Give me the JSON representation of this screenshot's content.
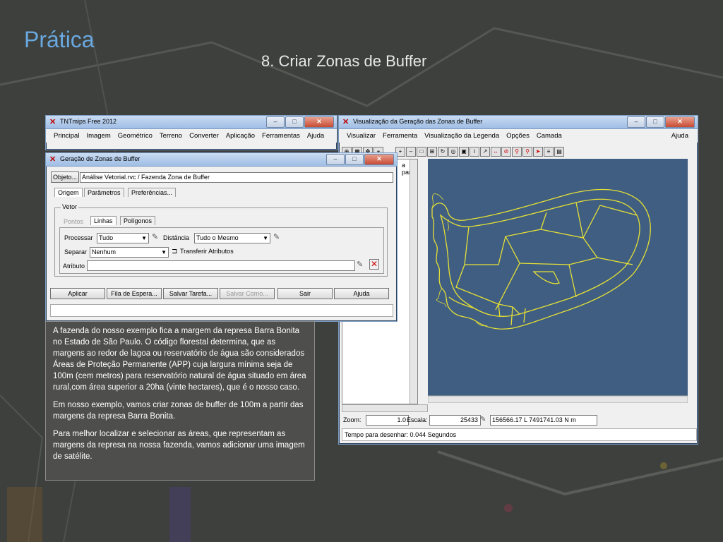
{
  "slide": {
    "title": "Prática",
    "subtitle": "8. Criar Zonas de Buffer"
  },
  "tnt_window": {
    "title": "TNTmips Free 2012",
    "menu": [
      "Principal",
      "Imagem",
      "Geométrico",
      "Terreno",
      "Converter",
      "Aplicação",
      "Ferramentas",
      "Ajuda"
    ]
  },
  "buffer_dialog": {
    "title": "Geração de Zonas de Buffer",
    "object_button": "Objeto...",
    "object_path": "Análise Vetorial.rvc / Fazenda Zona de Buffer",
    "tabs": [
      "Origem",
      "Parâmetros",
      "Preferências..."
    ],
    "group_label": "Vetor",
    "subtabs": [
      "Pontos",
      "Linhas",
      "Polígonos"
    ],
    "process_label": "Processar",
    "process_value": "Tudo",
    "distance_label": "Distância",
    "distance_value": "Tudo o Mesmo",
    "separate_label": "Separar",
    "separate_value": "Nenhum",
    "transfer_label": "Transferir Atributos",
    "attribute_label": "Atributo",
    "buttons": [
      "Aplicar",
      "Fila de Espera...",
      "Salvar Tarefa...",
      "Salvar Como...",
      "Sair",
      "Ajuda"
    ]
  },
  "viz_window": {
    "title": "Visualização da Geração das Zonas de Buffer",
    "menu": [
      "Visualizar",
      "Ferramenta",
      "Visualização da Legenda",
      "Opções",
      "Camada"
    ],
    "help": "Ajuda",
    "side_text": "a para",
    "zoom_label": "Zoom:",
    "zoom_value": "1.0",
    "scale_label": "Escala:",
    "scale_value": "25433",
    "coords": "156566.17 L 7491741.03 N m",
    "status": "Tempo para desenhar: 0.044 Segundos",
    "map_bg": "#3f5e82",
    "line_color": "#e6e035"
  },
  "description": {
    "p1": "A fazenda do nosso exemplo fica a margem da represa Barra Bonita no Estado de São Paulo. O código florestal determina, que as margens ao redor de lagoa ou reservatório de água são considerados Áreas de Proteção Permanente (APP) cuja largura mínima seja de 100m (cem metros) para reservatório natural de água situado em área rural,com área superior a 20ha (vinte hectares), que é o nosso caso.",
    "p2": "Em nosso exemplo, vamos criar zonas de buffer de 100m a partir das margens da represa Barra Bonita.",
    "p3": "Para melhor localizar e selecionar as áreas, que representam as margens da represa na nossa fazenda, vamos adicionar uma imagem de satélite."
  }
}
